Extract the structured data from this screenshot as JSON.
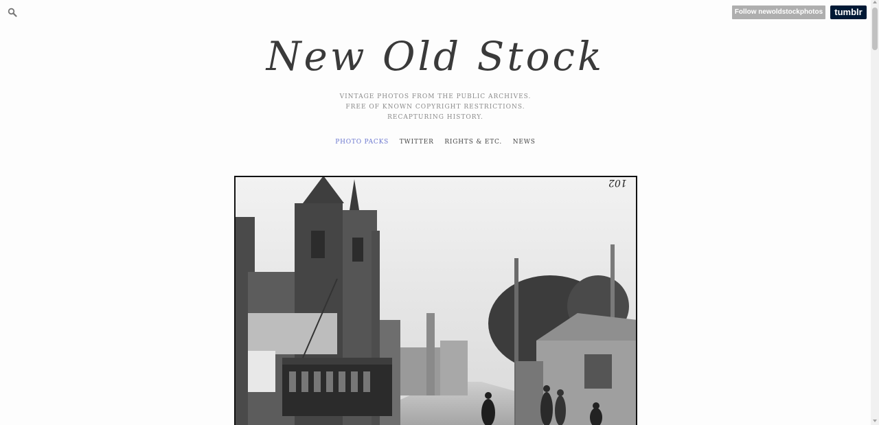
{
  "header": {
    "follow_label": "Follow newoldstockphotos",
    "tumblr_label": "tumblr"
  },
  "site": {
    "title": "New Old Stock",
    "description": [
      "VINTAGE PHOTOS FROM THE PUBLIC ARCHIVES.",
      "FREE OF KNOWN COPYRIGHT RESTRICTIONS.",
      "RECAPTURING HISTORY."
    ]
  },
  "nav": {
    "items": [
      {
        "label": "PHOTO PACKS",
        "active": true
      },
      {
        "label": "TWITTER",
        "active": false
      },
      {
        "label": "RIGHTS & ETC.",
        "active": false
      },
      {
        "label": "NEWS",
        "active": false
      }
    ]
  },
  "photo": {
    "plate_number": "102"
  },
  "colors": {
    "accent": "#6b77cf",
    "tumblr": "#001935",
    "follow": "#aeaeae"
  }
}
